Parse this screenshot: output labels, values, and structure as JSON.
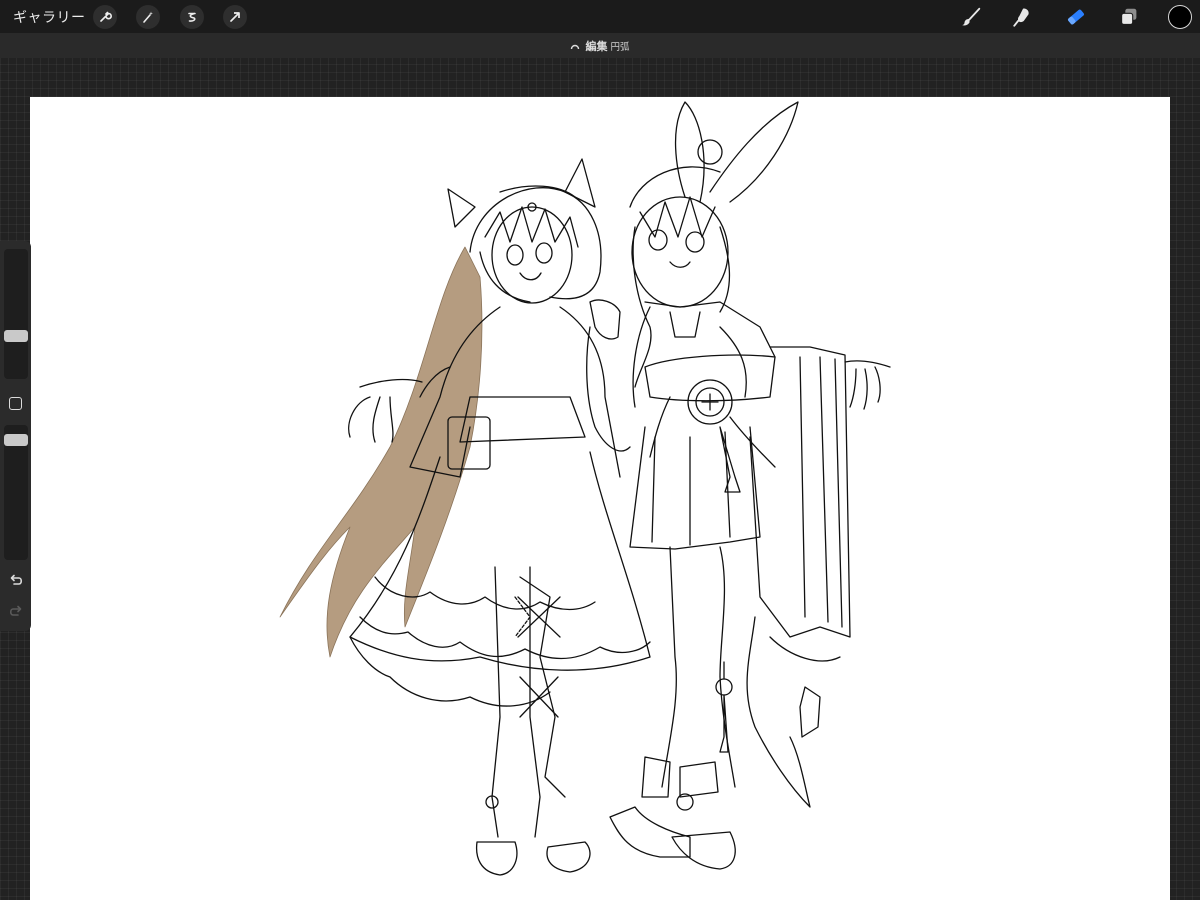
{
  "topbar": {
    "gallery_label": "ギャラリー",
    "left_tools": [
      "wrench-icon",
      "magic-wand-icon",
      "selection-icon",
      "transform-arrow-icon"
    ],
    "right_tools": [
      "brush-icon",
      "smudge-icon",
      "eraser-icon",
      "layers-icon"
    ],
    "active_tool": "eraser-icon",
    "active_color": "#000000",
    "accent_color": "#2a7fff"
  },
  "subbar": {
    "edit_label": "編集",
    "mode_label": "円弧"
  },
  "sidebar": {
    "icons": [
      "brush-size-slider",
      "modify-square-icon",
      "opacity-slider",
      "undo-icon",
      "redo-icon"
    ]
  },
  "canvas": {
    "content": "line-art-illustration",
    "hair_fill_color": "#b59c80",
    "line_color": "#111111"
  }
}
